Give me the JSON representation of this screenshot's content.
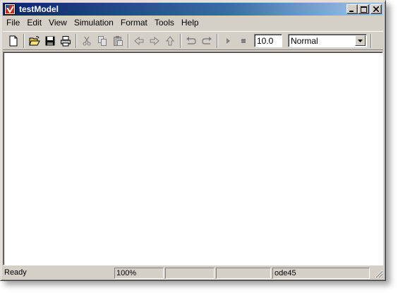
{
  "window": {
    "title": "testModel"
  },
  "titlebar_buttons": {
    "minimize": "minimize-icon",
    "maximize": "maximize-icon",
    "close": "close-icon"
  },
  "menu": {
    "items": [
      "File",
      "Edit",
      "View",
      "Simulation",
      "Format",
      "Tools",
      "Help"
    ]
  },
  "toolbar": {
    "icons": [
      "new-icon",
      "open-icon",
      "save-icon",
      "print-icon",
      "cut-icon",
      "copy-icon",
      "paste-icon",
      "back-icon",
      "forward-icon",
      "up-icon",
      "undo-icon",
      "redo-icon",
      "start-icon",
      "stop-icon"
    ],
    "stop_time": "10.0",
    "sim_mode": "Normal"
  },
  "status": {
    "ready": "Ready",
    "zoom": "100%",
    "blank1": "",
    "blank2": "",
    "solver": "ode45"
  },
  "colors": {
    "face": "#d4d0c8",
    "title_start": "#0a246a",
    "title_end": "#a6caf0",
    "canvas": "#ffffff"
  }
}
